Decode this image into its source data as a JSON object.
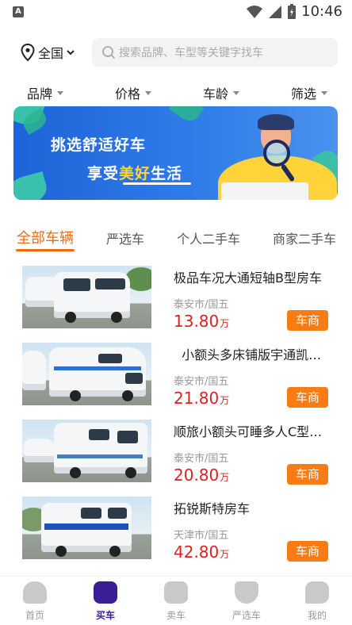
{
  "status_bar": {
    "time": "10:46"
  },
  "search": {
    "city": "全国",
    "placeholder": "搜索品牌、车型等关键字找车"
  },
  "filters": [
    "品牌",
    "价格",
    "车龄",
    "筛选"
  ],
  "banner": {
    "line1": "挑选舒适好车",
    "line2_prefix": "享受",
    "line2_highlight": "美好",
    "line2_suffix": "生活"
  },
  "tabs": [
    "全部车辆",
    "严选车",
    "个人二手车",
    "商家二手车"
  ],
  "listings": [
    {
      "title": "极品车况大通短轴B型房车",
      "location": "泰安市/国五",
      "price": "13.80",
      "unit": "万",
      "badge": "车商"
    },
    {
      "title": "  小额头多床铺版宇通凯…",
      "location": "泰安市/国五",
      "price": "21.80",
      "unit": "万",
      "badge": "车商"
    },
    {
      "title": "顺旅小额头可睡多人C型…",
      "location": "泰安市/国五",
      "price": "20.80",
      "unit": "万",
      "badge": "车商"
    },
    {
      "title": "拓锐斯特房车",
      "location": "天津市/国五",
      "price": "42.80",
      "unit": "万",
      "badge": "车商"
    }
  ],
  "bottom_nav": [
    "首页",
    "买车",
    "卖车",
    "严选车",
    "我的"
  ],
  "colors": {
    "accent": "#f36b11",
    "price": "#e02020",
    "badge": "#f97b13",
    "nav_active": "#3a1e96"
  }
}
